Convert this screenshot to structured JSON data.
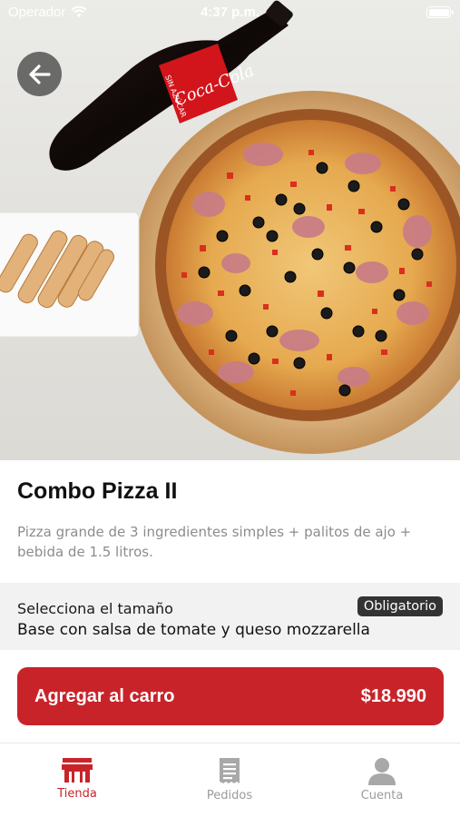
{
  "status_bar": {
    "carrier": "Operador",
    "time": "4:37 p.m."
  },
  "product": {
    "name": "Combo Pizza II",
    "description": "Pizza grande de 3 ingredientes simples + palitos de ajo + bebida de 1.5 litros."
  },
  "options": {
    "label": "Selecciona el tamaño",
    "required_badge": "Obligatorio",
    "selected_value": "Base con salsa de tomate y queso mozzarella"
  },
  "cart_button": {
    "label": "Agregar al carro",
    "price": "$18.990"
  },
  "tabs": [
    {
      "label": "Tienda",
      "icon": "store-icon",
      "active": true
    },
    {
      "label": "Pedidos",
      "icon": "receipt-icon",
      "active": false
    },
    {
      "label": "Cuenta",
      "icon": "person-icon",
      "active": false
    }
  ],
  "product_image": {
    "bottle_label": "Coca-Cola",
    "bottle_sub": "SIN AZÚCAR"
  },
  "colors": {
    "accent": "#c9232a",
    "badge": "#333333",
    "section_bg": "#f2f2f2"
  }
}
